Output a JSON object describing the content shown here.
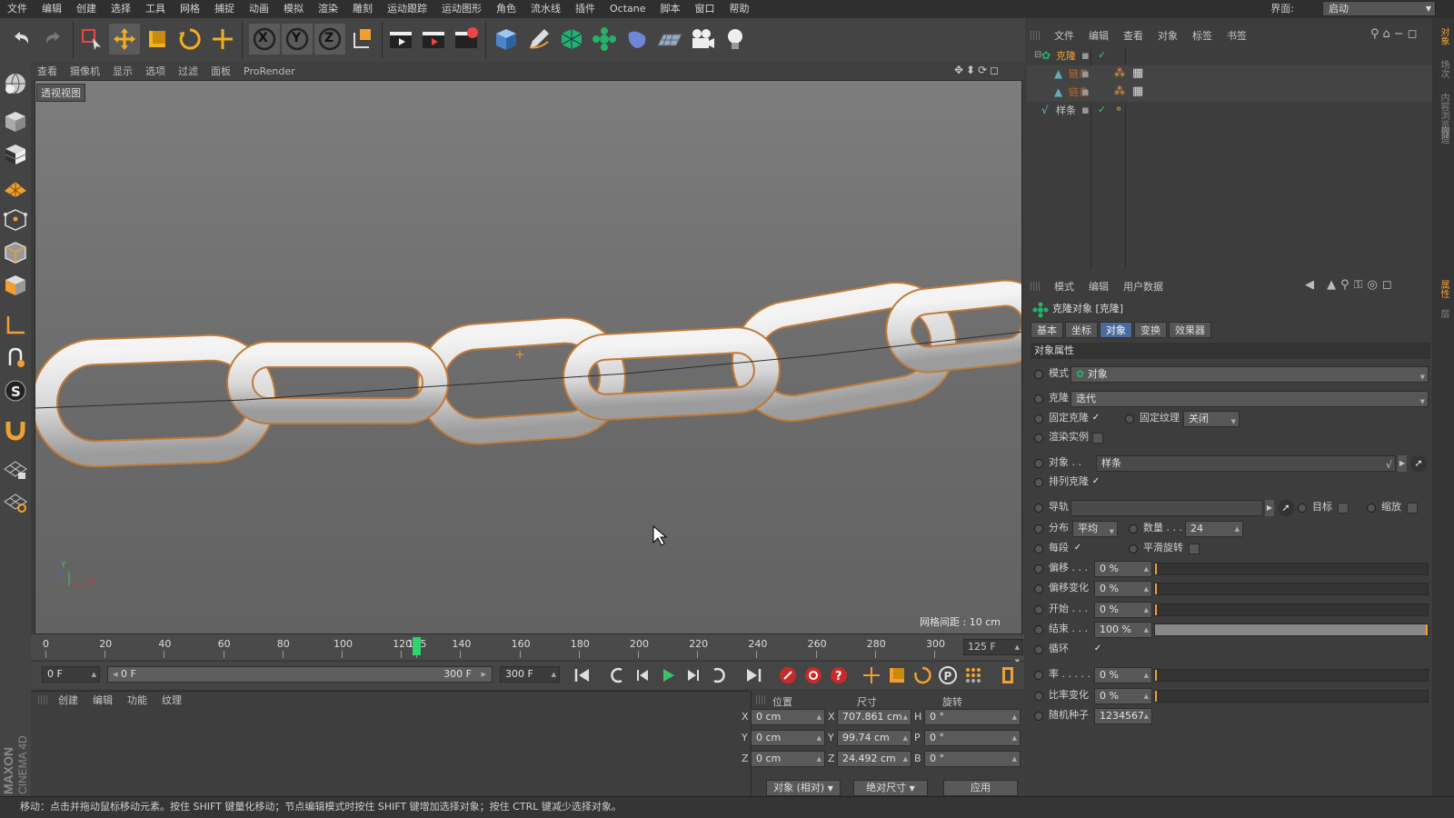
{
  "menu": [
    "文件",
    "编辑",
    "创建",
    "选择",
    "工具",
    "网格",
    "捕捉",
    "动画",
    "模拟",
    "渲染",
    "雕刻",
    "运动跟踪",
    "运动图形",
    "角色",
    "流水线",
    "插件",
    "Octane",
    "脚本",
    "窗口",
    "帮助"
  ],
  "layout": {
    "label": "界面:",
    "value": "启动"
  },
  "toolbar": {
    "undo": "undo-icon",
    "redo": "redo-icon",
    "live_select": "live-select-icon",
    "move": "move-icon",
    "scale": "scale-icon",
    "rotate": "rotate-icon",
    "last_tool": "move-icon",
    "axis_x": "X",
    "axis_y": "Y",
    "axis_z": "Z",
    "coord_system": "coordinate-system-icon",
    "render_view": "render-view-icon",
    "render_picture_viewer": "render-picture-viewer-icon",
    "render_settings": "render-settings-icon",
    "cube": "cube-icon",
    "pen": "pen-icon",
    "subdivision": "subdivision-icon",
    "cloner": "cloner-icon",
    "deformer": "deformer-icon",
    "floor": "floor-icon",
    "camera": "camera-icon",
    "light": "light-icon"
  },
  "viewport": {
    "menu": [
      "查看",
      "摄像机",
      "显示",
      "选项",
      "过滤",
      "面板",
      "ProRender"
    ],
    "label": "透视视图",
    "grid_spacing": "网格间距 : 10 cm",
    "axis_x": "X",
    "axis_y": "Y",
    "axis_z": "Z"
  },
  "timeline": {
    "ticks": [
      "0",
      "20",
      "40",
      "60",
      "80",
      "100",
      "120",
      "125",
      "140",
      "160",
      "180",
      "200",
      "220",
      "240",
      "260",
      "280",
      "300"
    ],
    "current_frame": 125,
    "end_field": "125 F",
    "start_field": "0 F",
    "range_start": "0 F",
    "range_end": "300 F",
    "max_field": "300 F"
  },
  "material_panel": {
    "menu": [
      "创建",
      "编辑",
      "功能",
      "纹理"
    ]
  },
  "coordinates": {
    "headers": {
      "position": "位置",
      "size": "尺寸",
      "rotation": "旋转"
    },
    "rows": [
      {
        "axis": "X",
        "pos": "0 cm",
        "size_axis": "X",
        "size": "707.861 cm",
        "rot_axis": "H",
        "rot": "0 °"
      },
      {
        "axis": "Y",
        "pos": "0 cm",
        "size_axis": "Y",
        "size": "99.74 cm",
        "rot_axis": "P",
        "rot": "0 °"
      },
      {
        "axis": "Z",
        "pos": "0 cm",
        "size_axis": "Z",
        "size": "24.492 cm",
        "rot_axis": "B",
        "rot": "0 °"
      }
    ],
    "mode": "对象 (相对)",
    "size_mode": "绝对尺寸",
    "apply": "应用"
  },
  "status": "移动：点击并拖动鼠标移动元素。按住 SHIFT 键量化移动；节点编辑模式时按住 SHIFT 键增加选择对象；按住 CTRL 键减少选择对象。",
  "objects": {
    "menu": [
      "文件",
      "编辑",
      "查看",
      "对象",
      "标签",
      "书签"
    ],
    "items": [
      {
        "name": "克隆",
        "color": "#f0a030"
      },
      {
        "name": "链条",
        "color": "#b86a2a"
      },
      {
        "name": "链条",
        "color": "#b86a2a"
      },
      {
        "name": "样条",
        "color": "#c8c8c8"
      }
    ]
  },
  "attributes": {
    "menu": [
      "模式",
      "编辑",
      "用户数据"
    ],
    "title": "克隆对象 [克隆]",
    "tabs": [
      "基本",
      "坐标",
      "对象",
      "变换",
      "效果器"
    ],
    "active_tab": "对象",
    "section": "对象属性",
    "mode_label": "模式",
    "mode_value": "对象",
    "clone_label": "克隆",
    "clone_value": "迭代",
    "fix_clone": "固定克隆",
    "fix_texture": "固定纹理",
    "fix_texture_value": "关闭",
    "render_instances": "渲染实例",
    "object_label": "对象 . .",
    "object_value": "样条",
    "align_clone": "排列克隆",
    "rail": "导轨",
    "target": "目标",
    "scale": "缩放",
    "distribution": "分布",
    "distribution_value": "平均",
    "count_label": "数量 . . .",
    "count": "24",
    "per_segment": "每段",
    "smooth_rotation": "平滑旋转",
    "offset_label": "偏移 . . .",
    "offset": "0 %",
    "offset_var_label": "偏移变化",
    "offset_var": "0 %",
    "start_label": "开始 . . .",
    "start": "0 %",
    "end_label": "结束 . . .",
    "end": "100 %",
    "end_fraction": 1.0,
    "loop": "循环",
    "rate_label": "率 . . . . .",
    "rate": "0 %",
    "rate_var_label": "比率变化",
    "rate_var": "0 %",
    "seed_label": "随机种子",
    "seed": "1234567"
  },
  "right_strip": [
    "对象",
    "场次",
    "内容浏览器",
    "构造"
  ],
  "right_strip2": [
    "属性",
    "层"
  ],
  "branding": "MAXON CINEMA 4D",
  "colors": {
    "accent": "#4a6b9c",
    "playhead": "#2fd46c",
    "selection": "#f0a030"
  }
}
